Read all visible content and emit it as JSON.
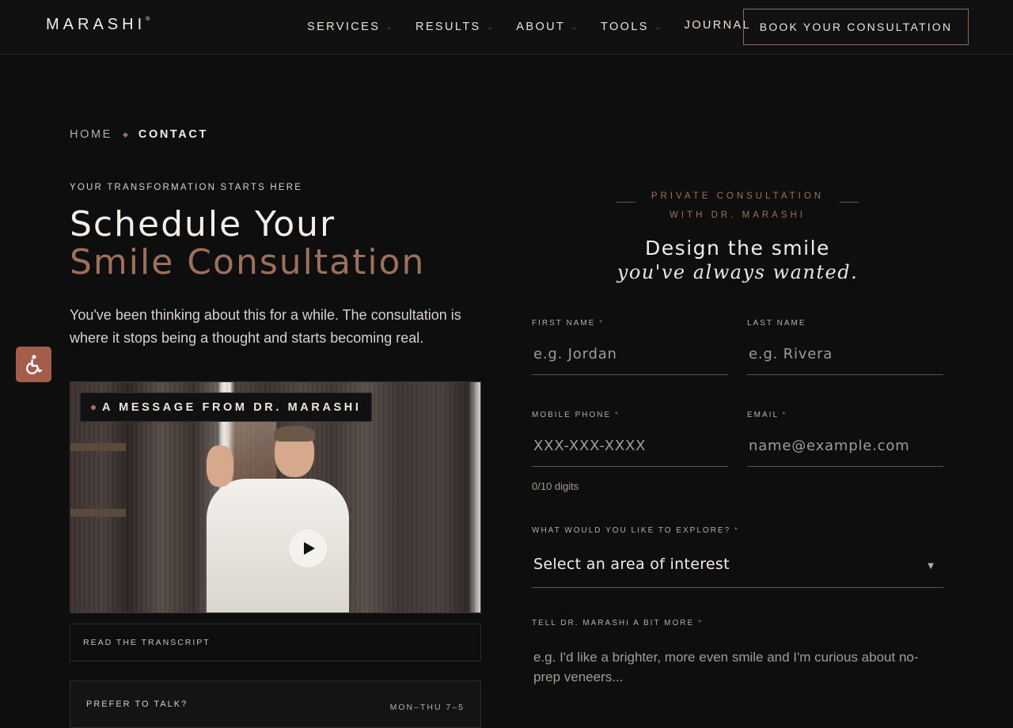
{
  "header": {
    "logo": "MARASHI",
    "logo_mark": "®",
    "nav": [
      {
        "label": "SERVICES",
        "dropdown": true
      },
      {
        "label": "RESULTS",
        "dropdown": true
      },
      {
        "label": "ABOUT",
        "dropdown": true
      },
      {
        "label": "TOOLS",
        "dropdown": true
      },
      {
        "label": "JOURNAL",
        "dropdown": false
      }
    ],
    "cta": "BOOK YOUR CONSULTATION"
  },
  "breadcrumb": {
    "home": "HOME",
    "current": "CONTACT"
  },
  "hero": {
    "eyebrow": "YOUR TRANSFORMATION STARTS HERE",
    "title_line1": "Schedule Your",
    "title_line2": "Smile Consultation",
    "intro": "You've been thinking about this for a while. The consultation is where it stops being a thought and starts becoming real."
  },
  "video": {
    "tag": "A MESSAGE FROM DR. MARASHI"
  },
  "transcript_label": "READ THE TRANSCRIPT",
  "talk": {
    "label": "PREFER TO TALK?",
    "hours": "MON–THU 7–5"
  },
  "form": {
    "eyebrow_line1": "PRIVATE CONSULTATION",
    "eyebrow_line2": "WITH DR. MARASHI",
    "title_line1": "Design the smile",
    "title_line2": "you've always wanted.",
    "first_name": {
      "label": "FIRST NAME",
      "placeholder": "e.g. Jordan"
    },
    "last_name": {
      "label": "LAST NAME",
      "placeholder": "e.g. Rivera"
    },
    "phone": {
      "label": "MOBILE PHONE",
      "placeholder": "XXX-XXX-XXXX",
      "hint": "0/10 digits"
    },
    "email": {
      "label": "EMAIL",
      "placeholder": "name@example.com"
    },
    "explore": {
      "label": "WHAT WOULD YOU LIKE TO EXPLORE?",
      "selected": "Select an area of interest"
    },
    "more": {
      "label": "TELL DR. MARASHI A BIT MORE",
      "placeholder": "e.g. I'd like a brighter, more even smile and I'm curious about no-prep veneers..."
    },
    "required_mark": "*"
  },
  "colors": {
    "accent": "#9c705a",
    "background": "#0f0e0e",
    "access_button": "#a35d4a"
  }
}
